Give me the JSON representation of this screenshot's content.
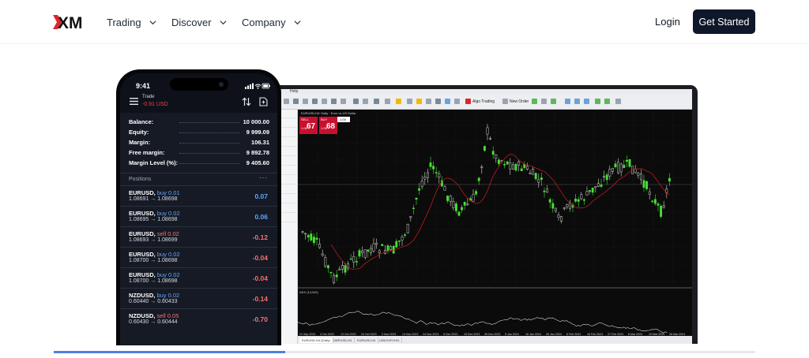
{
  "header": {
    "logo_text": "XM",
    "nav": [
      {
        "label": "Trading"
      },
      {
        "label": "Discover"
      },
      {
        "label": "Company"
      }
    ],
    "login_label": "Login",
    "cta_label": "Get Started"
  },
  "desktop": {
    "menu_label": "Help",
    "toolbar_algo": "Algo Trading",
    "toolbar_new_order": "New Order",
    "chart_title": "EURUSD,H4: Daily · Euro vs US Dollar",
    "sell_label": "SELL",
    "buy_label": "BUY",
    "lot": "1.00",
    "sell_small": "1.08",
    "sell_big": "67",
    "sell_sup": "3",
    "buy_small": "1.08",
    "buy_big": "68",
    "buy_sup": "7",
    "indicator_label": "ADX (14,NG)",
    "x_labels": [
      "21 Sep 2023",
      "3 Oct 2023",
      "13 Oct 2023",
      "24 Oct 2023",
      "3 Nov 2023",
      "14 Nov 2023",
      "24 Nov 2023",
      "5 Dec 2023",
      "15 Dec 2023",
      "26 Dec 2023",
      "5 Jan 2024",
      "16 Jan 2024",
      "26 Jan 2024",
      "6 Feb 2024",
      "16 Feb 2024",
      "27 Feb 2024",
      "8 Mar 2024",
      "19 Mar 2024",
      "28 Mar 2024"
    ],
    "tabs": [
      "EURUSD,H4 (Daily)",
      "GBPUSD,H4",
      "EURUSD,H4",
      "USDCHF,H1D"
    ]
  },
  "phone": {
    "time": "9:41",
    "title": "Trade",
    "pnl": "-0.91 USD",
    "account": [
      {
        "label": "Balance:",
        "value": "10 000.00"
      },
      {
        "label": "Equity:",
        "value": "9 999.09"
      },
      {
        "label": "Margin:",
        "value": "106.31"
      },
      {
        "label": "Free margin:",
        "value": "9 892.78"
      },
      {
        "label": "Margin Level (%):",
        "value": "9 405.60"
      }
    ],
    "positions_label": "Positions",
    "positions_more": "···",
    "positions": [
      {
        "symbol": "EURUSD,",
        "side": "buy 0.01",
        "dir": "buy",
        "prices": "1.08691 → 1.08698",
        "pl": "0.07"
      },
      {
        "symbol": "EURUSD,",
        "side": "buy 0.02",
        "dir": "buy",
        "prices": "1.08695 → 1.08698",
        "pl": "0.06"
      },
      {
        "symbol": "EURUSD,",
        "side": "sell 0.02",
        "dir": "sell",
        "prices": "1.08693 → 1.08699",
        "pl": "-0.12"
      },
      {
        "symbol": "EURUSD,",
        "side": "buy 0.02",
        "dir": "buy",
        "prices": "1.08700 → 1.08698",
        "pl": "-0.04"
      },
      {
        "symbol": "EURUSD,",
        "side": "buy 0.02",
        "dir": "buy",
        "prices": "1.08700 → 1.08698",
        "pl": "-0.04"
      },
      {
        "symbol": "NZDUSD,",
        "side": "buy 0.02",
        "dir": "buy",
        "prices": "0.60440 → 0.60433",
        "pl": "-0.14"
      },
      {
        "symbol": "NZDUSD,",
        "side": "sell 0.05",
        "dir": "sell",
        "prices": "0.60430 → 0.60444",
        "pl": "-0.70"
      }
    ]
  },
  "progress": {
    "fraction": 0.33
  },
  "colors": {
    "accent": "#0f172a",
    "logo_red": "#e0242b",
    "buy": "#60a5fa",
    "sell": "#f87171",
    "candle_up": "#4ade36",
    "progress": "#4f7fe0"
  }
}
